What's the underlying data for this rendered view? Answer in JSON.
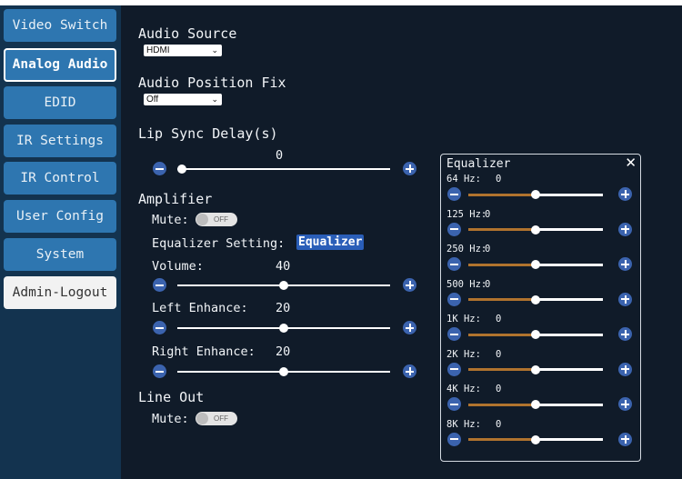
{
  "nav": {
    "items": [
      {
        "label": "Video Switch",
        "active": false
      },
      {
        "label": "Analog Audio",
        "active": true
      },
      {
        "label": "EDID",
        "active": false
      },
      {
        "label": "IR Settings",
        "active": false
      },
      {
        "label": "IR Control",
        "active": false
      },
      {
        "label": "User Config",
        "active": false
      },
      {
        "label": "System",
        "active": false
      },
      {
        "label": "Admin-Logout",
        "active": false
      }
    ]
  },
  "audio": {
    "source_label": "Audio Source",
    "source_value": "HDMI",
    "position_fix_label": "Audio Position Fix",
    "position_fix_value": "Off",
    "lip_sync_label": "Lip Sync Delay(s)",
    "lip_sync_value": "0",
    "lip_sync_level": 0
  },
  "amplifier": {
    "title": "Amplifier",
    "mute_label": "Mute:",
    "mute_state": "OFF",
    "eq_setting_label": "Equalizer Setting:",
    "eq_button": "Equalizer",
    "volume_label": "Volume:",
    "volume_value": "40",
    "volume_level": 0.5,
    "left_label": "Left Enhance:",
    "left_value": "20",
    "left_level": 0.5,
    "right_label": "Right Enhance:",
    "right_value": "20",
    "right_level": 0.5
  },
  "lineout": {
    "title": "Line Out",
    "mute_label": "Mute:",
    "mute_state": "OFF"
  },
  "equalizer": {
    "title": "Equalizer",
    "close_icon": "close-icon",
    "bands": [
      {
        "freq": "64 Hz:",
        "value": "0",
        "level": 0.5
      },
      {
        "freq": "125 Hz:",
        "value": "0",
        "level": 0.5
      },
      {
        "freq": "250 Hz:",
        "value": "0",
        "level": 0.5
      },
      {
        "freq": "500 Hz:",
        "value": "0",
        "level": 0.5
      },
      {
        "freq": "1K Hz:",
        "value": "0",
        "level": 0.5
      },
      {
        "freq": "2K Hz:",
        "value": "0",
        "level": 0.5
      },
      {
        "freq": "4K Hz:",
        "value": "0",
        "level": 0.5
      },
      {
        "freq": "8K Hz:",
        "value": "0",
        "level": 0.5
      }
    ]
  },
  "colors": {
    "sidebar": "#13334f",
    "nav_button": "#2e76b0",
    "main_bg": "#101b29",
    "accent": "#3b63ae",
    "eq_fill": "#b0732e"
  }
}
